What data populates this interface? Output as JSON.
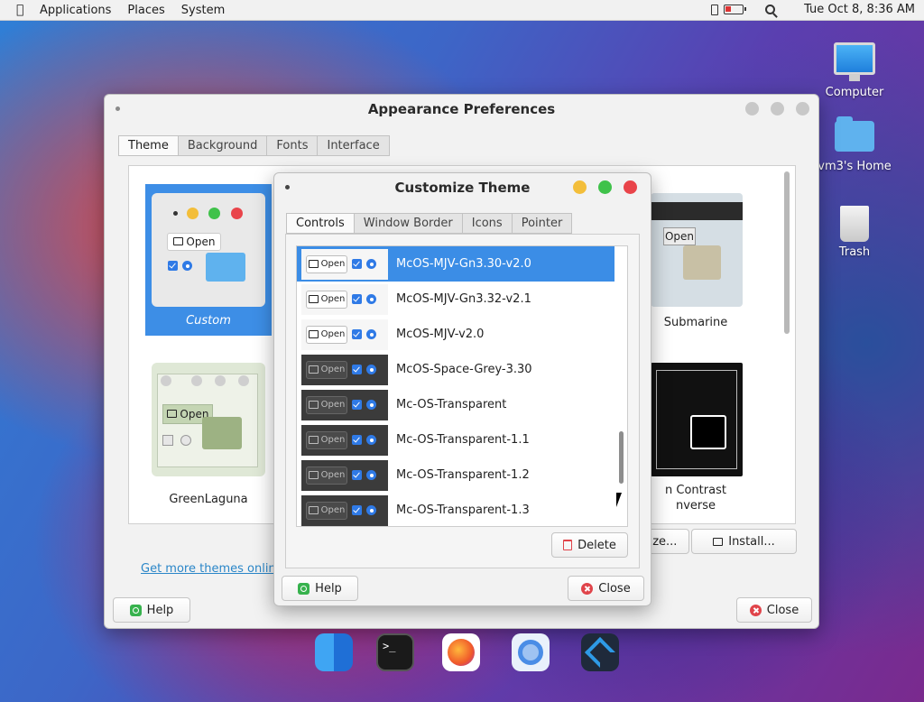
{
  "menubar": {
    "items": [
      "Applications",
      "Places",
      "System"
    ],
    "clock": "Tue Oct  8,  8:36 AM"
  },
  "desktop": {
    "icons": [
      {
        "label": "Computer",
        "icon": "computer-icon"
      },
      {
        "label": "vm3's Home",
        "icon": "home-folder-icon"
      },
      {
        "label": "Trash",
        "icon": "trash-icon"
      }
    ]
  },
  "appearance": {
    "title": "Appearance Preferences",
    "tabs": [
      "Theme",
      "Background",
      "Fonts",
      "Interface"
    ],
    "themes": [
      "Custom",
      "GreenLaguna",
      "Submarine",
      "n Contrast",
      "nverse"
    ],
    "more_link": "Get more themes online",
    "customize_button": "ize...",
    "install_button": "Install...",
    "help_button": "Help",
    "close_button": "Close"
  },
  "preview_open_label": "Open",
  "customize": {
    "title": "Customize Theme",
    "tabs": [
      "Controls",
      "Window Border",
      "Icons",
      "Pointer"
    ],
    "items": [
      {
        "name": "McOS-MJV-Gn3.30-v2.0",
        "style": "light",
        "selected": true
      },
      {
        "name": "McOS-MJV-Gn3.32-v2.1",
        "style": "light",
        "selected": false
      },
      {
        "name": "McOS-MJV-v2.0",
        "style": "light",
        "selected": false
      },
      {
        "name": "McOS-Space-Grey-3.30",
        "style": "dark",
        "selected": false
      },
      {
        "name": "Mc-OS-Transparent",
        "style": "dark",
        "selected": false
      },
      {
        "name": "Mc-OS-Transparent-1.1",
        "style": "dark",
        "selected": false
      },
      {
        "name": "Mc-OS-Transparent-1.2",
        "style": "dark",
        "selected": false
      },
      {
        "name": "Mc-OS-Transparent-1.3",
        "style": "dark",
        "selected": false
      }
    ],
    "delete_button": "Delete",
    "help_button": "Help",
    "close_button": "Close"
  },
  "dock": [
    "finder-icon",
    "terminal-icon",
    "firefox-icon",
    "chromium-icon",
    "vscode-icon"
  ],
  "colors": {
    "selection": "#3b8de6",
    "close_red": "#e9444a",
    "minimize_yellow": "#f3be3a",
    "zoom_green": "#3fc24a"
  }
}
